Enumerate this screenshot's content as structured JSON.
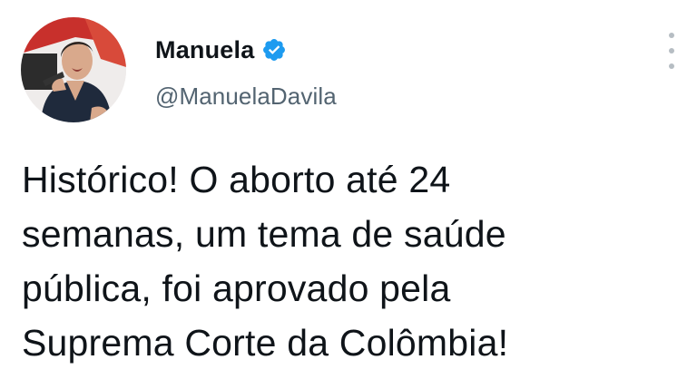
{
  "author": {
    "display_name": "Manuela",
    "handle": "@ManuelaDavila",
    "verified": true,
    "badge_color": "#1d9bf0"
  },
  "tweet": {
    "text_lines": [
      "Histórico! O aborto até 24",
      "semanas, um tema de saúde",
      "pública, foi aprovado pela",
      "Suprema Corte da Colômbia!"
    ]
  },
  "icons": {
    "more": "more-vertical-icon",
    "verified": "verified-badge-icon"
  }
}
